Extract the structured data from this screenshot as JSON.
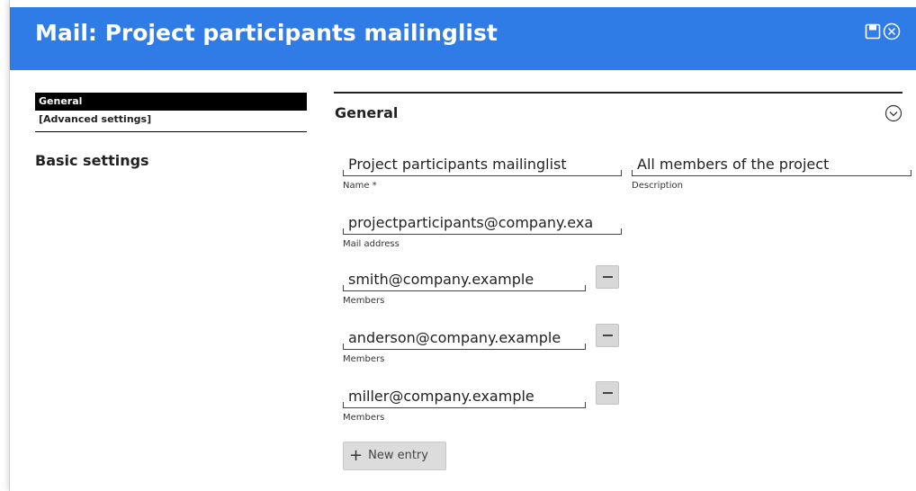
{
  "header": {
    "title": "Mail: Project participants mailinglist"
  },
  "sidebar": {
    "items": [
      {
        "label": "General",
        "active": true
      },
      {
        "label": "[Advanced settings]",
        "active": false
      }
    ],
    "section_title": "Basic settings"
  },
  "main": {
    "section_title": "General",
    "name": {
      "value": "Project participants mailinglist",
      "label": "Name *"
    },
    "description": {
      "value": "All members of the project",
      "label": "Description"
    },
    "mail_address": {
      "value": "projectparticipants@company.exa",
      "label": "Mail address"
    },
    "members": [
      {
        "value": "smith@company.example",
        "label": "Members"
      },
      {
        "value": "anderson@company.example",
        "label": "Members"
      },
      {
        "value": "miller@company.example",
        "label": "Members"
      }
    ],
    "new_entry_label": "New entry"
  },
  "colors": {
    "header_bg": "#2f7ce6",
    "active_nav_bg": "#000000",
    "button_bg": "#d8d8d8"
  }
}
